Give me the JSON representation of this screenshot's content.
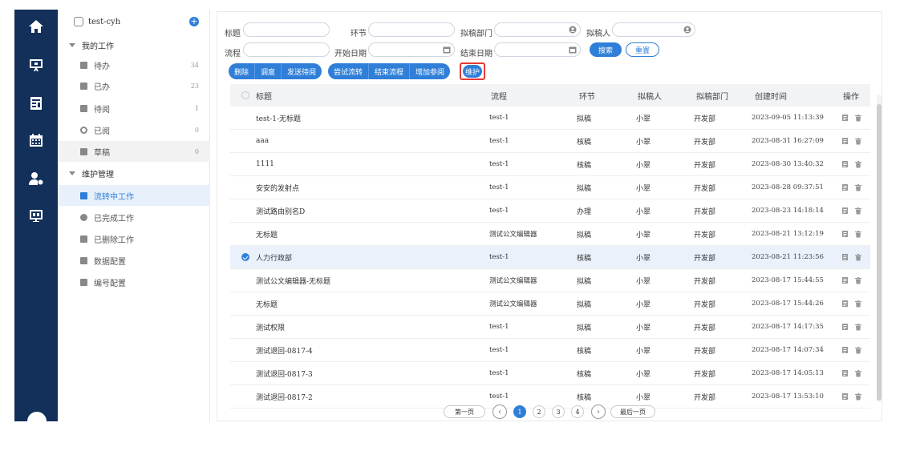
{
  "sidebar": {
    "user": "test-cyh",
    "add_symbol": "+",
    "groups": [
      {
        "label": "我的工作"
      },
      {
        "label": "维护管理"
      }
    ],
    "work_items": [
      {
        "label": "待办",
        "count": "34",
        "icon": "doc-icon"
      },
      {
        "label": "已办",
        "count": "23",
        "icon": "stamp-icon"
      },
      {
        "label": "待阅",
        "count": "1",
        "icon": "page-icon"
      },
      {
        "label": "已阅",
        "count": "0",
        "icon": "eye-icon"
      },
      {
        "label": "草稿",
        "count": "0",
        "icon": "draft-icon"
      }
    ],
    "maint_items": [
      {
        "label": "流转中工作",
        "icon": "flow-icon"
      },
      {
        "label": "已完成工作",
        "icon": "check-circle-icon"
      },
      {
        "label": "已删除工作",
        "icon": "trash-box-icon"
      },
      {
        "label": "数据配置",
        "icon": "list-config-icon"
      },
      {
        "label": "编号配置",
        "icon": "number-config-icon"
      }
    ]
  },
  "filters": {
    "title_label": "标题",
    "step_label": "环节",
    "dept_label": "拟稿部门",
    "drafter_label": "拟稿人",
    "flow_label": "流程",
    "start_label": "开始日期",
    "end_label": "结束日期",
    "search_label": "搜索",
    "reset_label": "重置"
  },
  "toolbar": {
    "group1": [
      "删除",
      "调度",
      "发送待阅"
    ],
    "group2": [
      "尝试流转",
      "结束流程",
      "增加参阅"
    ],
    "maintain": "维护"
  },
  "table": {
    "headers": {
      "title": "标题",
      "flow": "流程",
      "step": "环节",
      "drafter": "拟稿人",
      "dept": "拟稿部门",
      "created": "创建时间",
      "ops": "操作"
    },
    "rows": [
      {
        "title": "test-1-无标题",
        "flow": "test-1",
        "step": "拟稿",
        "drafter": "小翠",
        "dept": "开发部",
        "created": "2023-09-05 11:13:39",
        "selected": false
      },
      {
        "title": "aaa",
        "flow": "test-1",
        "step": "核稿",
        "drafter": "小翠",
        "dept": "开发部",
        "created": "2023-08-31 16:27:09",
        "selected": false
      },
      {
        "title": "1111",
        "flow": "test-1",
        "step": "核稿",
        "drafter": "小翠",
        "dept": "开发部",
        "created": "2023-08-30 13:40:32",
        "selected": false
      },
      {
        "title": "安安的发射点",
        "flow": "test-1",
        "step": "拟稿",
        "drafter": "小翠",
        "dept": "开发部",
        "created": "2023-08-28 09:37:51",
        "selected": false
      },
      {
        "title": "测试路由别名D",
        "flow": "test-1",
        "step": "办理",
        "drafter": "小翠",
        "dept": "开发部",
        "created": "2023-08-23 14:18:14",
        "selected": false
      },
      {
        "title": "无标题",
        "flow": "测试公文编辑器",
        "step": "拟稿",
        "drafter": "小翠",
        "dept": "开发部",
        "created": "2023-08-21 13:12:19",
        "selected": false
      },
      {
        "title": "人力行政部",
        "flow": "test-1",
        "step": "核稿",
        "drafter": "小翠",
        "dept": "开发部",
        "created": "2023-08-21 11:23:56",
        "selected": true
      },
      {
        "title": "测试公文编辑器-无标题",
        "flow": "测试公文编辑器",
        "step": "拟稿",
        "drafter": "小翠",
        "dept": "开发部",
        "created": "2023-08-17 15:44:55",
        "selected": false
      },
      {
        "title": "无标题",
        "flow": "测试公文编辑器",
        "step": "拟稿",
        "drafter": "小翠",
        "dept": "开发部",
        "created": "2023-08-17 15:44:26",
        "selected": false
      },
      {
        "title": "测试权限",
        "flow": "test-1",
        "step": "拟稿",
        "drafter": "小翠",
        "dept": "开发部",
        "created": "2023-08-17 14:17:35",
        "selected": false
      },
      {
        "title": "测试退回-0817-4",
        "flow": "test-1",
        "step": "核稿",
        "drafter": "小翠",
        "dept": "开发部",
        "created": "2023-08-17 14:07:34",
        "selected": false
      },
      {
        "title": "测试退回-0817-3",
        "flow": "test-1",
        "step": "核稿",
        "drafter": "小翠",
        "dept": "开发部",
        "created": "2023-08-17 14:05:13",
        "selected": false
      },
      {
        "title": "测试退回-0817-2",
        "flow": "test-1",
        "step": "核稿",
        "drafter": "小翠",
        "dept": "开发部",
        "created": "2023-08-17 13:53:10",
        "selected": false
      }
    ]
  },
  "pagination": {
    "first": "第一页",
    "last": "最后一页",
    "pages": [
      "1",
      "2",
      "3",
      "4"
    ],
    "current": "1",
    "prev_symbol": "‹",
    "next_symbol": "›"
  },
  "colors": {
    "rail": "#12305a",
    "accent": "#2f7fd8",
    "highlight": "#e53935"
  }
}
